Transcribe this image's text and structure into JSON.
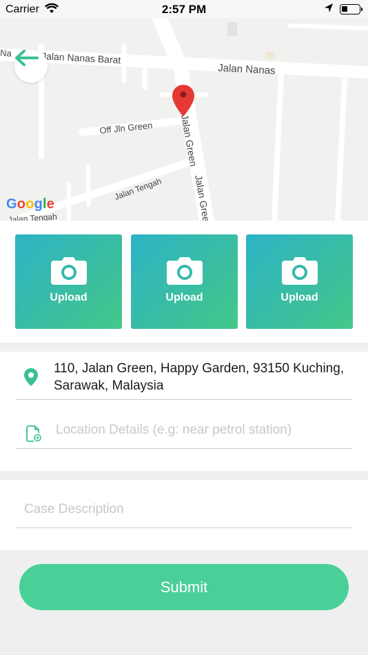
{
  "status_bar": {
    "carrier": "Carrier",
    "time": "2:57 PM"
  },
  "map": {
    "labels": {
      "road_1": "Jalan Nanas Barat",
      "road_1_left": "Na",
      "road_2": "Jalan Nanas",
      "road_3": "Off Jln Green",
      "road_4": "Jalan Green",
      "road_5": "Jalan Green",
      "road_6": "Jalan Tengah",
      "road_7": "Jalan Tengah"
    },
    "google_letters": [
      "G",
      "o",
      "o",
      "g",
      "l",
      "e"
    ],
    "pin_color": "#e53935"
  },
  "uploads": [
    {
      "label": "Upload"
    },
    {
      "label": "Upload"
    },
    {
      "label": "Upload"
    }
  ],
  "address": {
    "text": "110, Jalan Green, Happy Garden, 93150 Kuching, Sarawak, Malaysia"
  },
  "location_details": {
    "placeholder": "Location Details (e.g: near petrol station)",
    "value": ""
  },
  "case_description": {
    "placeholder": "Case Description",
    "value": ""
  },
  "submit": {
    "label": "Submit"
  },
  "colors": {
    "accent": "#4bcf99",
    "gradient_start": "#2db4c6",
    "gradient_end": "#44c988",
    "icon_green": "#3bbf94"
  }
}
